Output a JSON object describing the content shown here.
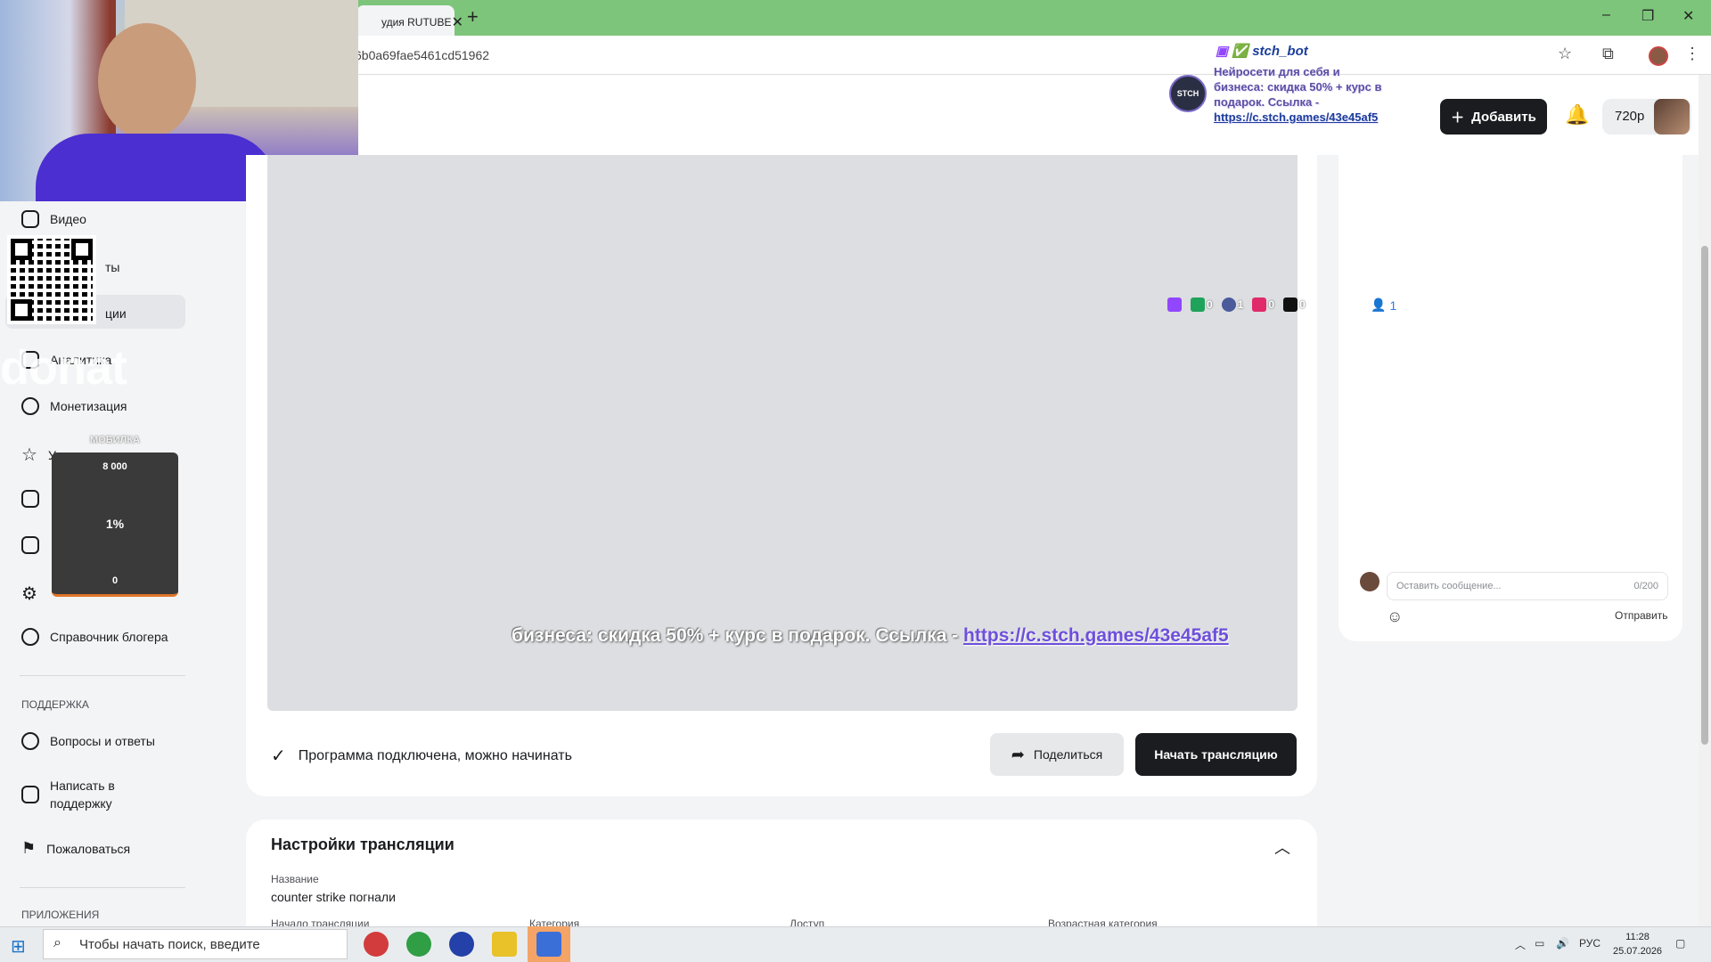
{
  "browser": {
    "tab_title": "удия RUTUBE",
    "tab_close": "✕",
    "new_tab": "+",
    "url": "6b0a69fae5461cd51962",
    "window_controls": [
      "–",
      "❐",
      "✕"
    ]
  },
  "header": {
    "add_label": "Добавить",
    "quality_label": "720p"
  },
  "overlay": {
    "bot_name": "stch_bot",
    "bot_logo": "STCH",
    "bot_text": "Нейросети для себя и бизнеса: скидка 50% + курс в подарок. Ссылка -",
    "bot_link": "https://c.stch.games/43e45af5",
    "donat_label": "donat",
    "goal_title": "МОБИЛКА",
    "goal_target": "8 000",
    "goal_percent": "1%",
    "goal_current": "0",
    "platform_counts": [
      {
        "icon": "twitch-icon",
        "count": "",
        "color": "#9146ff"
      },
      {
        "icon": "goodgame-icon",
        "count": "0",
        "color": "#1fa35b"
      },
      {
        "icon": "g-icon",
        "count": "1",
        "color": "#4a5a9a"
      },
      {
        "icon": "live-icon",
        "count": "0",
        "color": "#e02a6a"
      },
      {
        "icon": "r-icon",
        "count": "0",
        "color": "#111111"
      }
    ],
    "ticker_text": "бизнеса: скидка 50% + курс в подарок. Ссылка -",
    "ticker_link": "https://c.stch.games/43e45af5"
  },
  "sidebar": {
    "items": [
      {
        "label": "Видео",
        "icon": "video-icon"
      },
      {
        "label": "ты",
        "icon": "shorts-icon"
      },
      {
        "label": "ции",
        "icon": "broadcast-icon"
      },
      {
        "label": "Аналитика",
        "icon": "analytics-icon"
      },
      {
        "label": "Монетизация",
        "icon": "ruble-icon"
      },
      {
        "label": "Уровень канала",
        "icon": "star-icon"
      },
      {
        "label": "",
        "icon": "wallet-icon"
      },
      {
        "label": "",
        "icon": "comments-icon"
      },
      {
        "label": "",
        "icon": "settings-icon"
      },
      {
        "label": "Справочник блогера",
        "icon": "info-icon"
      }
    ],
    "support_title": "ПОДДЕРЖКА",
    "support_items": [
      {
        "label": "Вопросы и ответы",
        "icon": "question-icon"
      },
      {
        "label": "Написать в поддержку",
        "icon": "mail-icon"
      },
      {
        "label": "Пожаловаться",
        "icon": "flag-icon"
      }
    ],
    "apps_title": "ПРИЛОЖЕНИЯ"
  },
  "stream": {
    "status_text": "Программа подключена, можно начинать",
    "share_label": "Поделиться",
    "start_label": "Начать трансляцию"
  },
  "settings": {
    "title": "Настройки трансляции",
    "name_label": "Название",
    "name_value": "counter strike погнали",
    "start_label": "Начало трансляции",
    "category_label": "Категория",
    "access_label": "Доступ",
    "age_label": "Возрастная категория"
  },
  "chat": {
    "viewers": "1",
    "input_placeholder": "Оставить сообщение...",
    "char_count": "0/200",
    "send_label": "Отправить"
  },
  "taskbar": {
    "search_placeholder": "Чтобы начать поиск, введите",
    "lang": "РУС",
    "time": "11:28",
    "date": "25.07.2026"
  }
}
